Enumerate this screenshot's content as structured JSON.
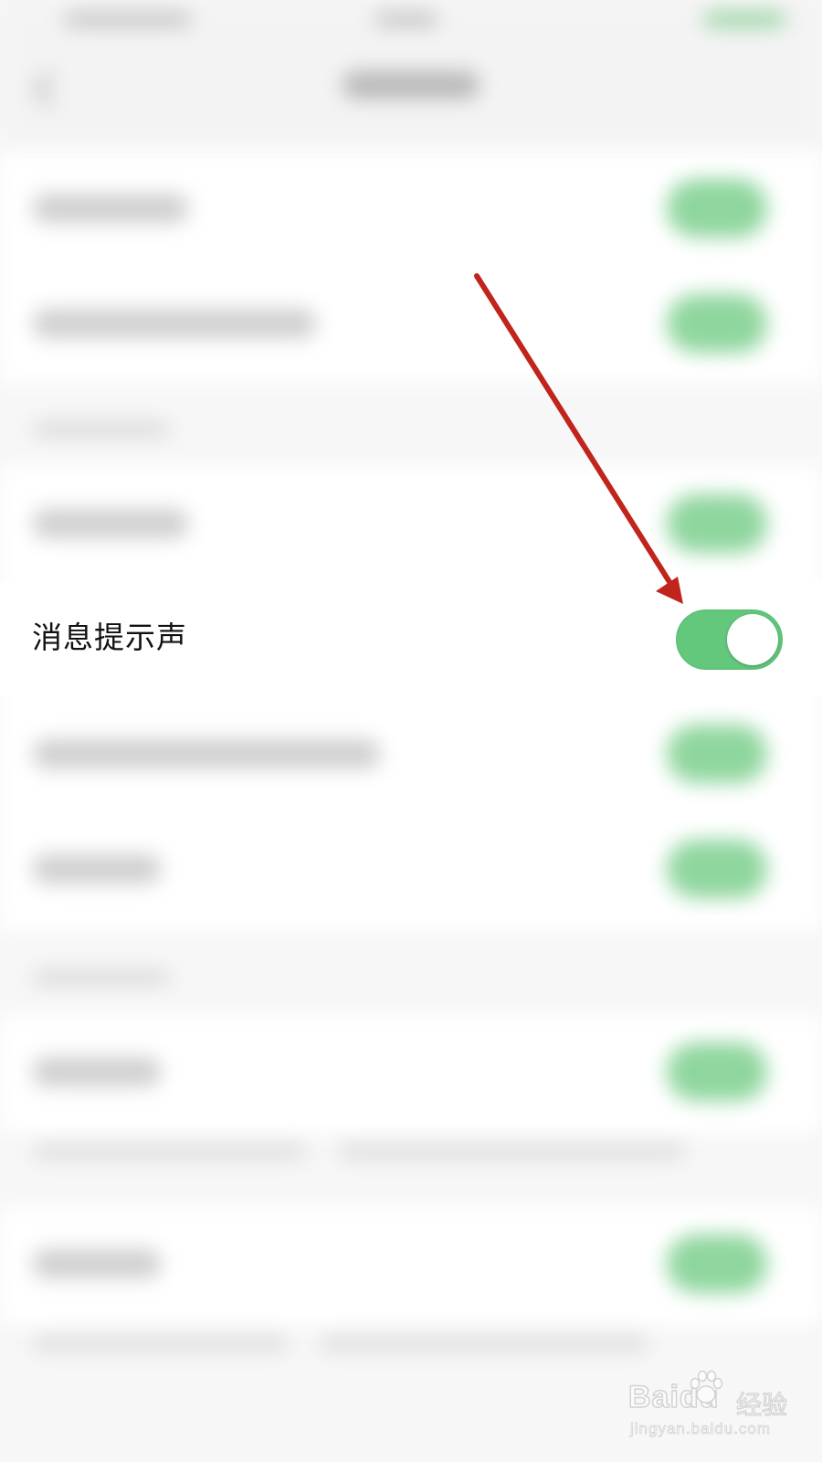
{
  "setting": {
    "label": "消息提示声",
    "enabled": true
  },
  "colors": {
    "toggle_on": "#63c77c",
    "arrow": "#c0241c",
    "background": "#f7f7f7"
  },
  "watermark": {
    "brand": "Baidu",
    "brand_cn": "经验",
    "url": "jingyan.baidu.com"
  }
}
